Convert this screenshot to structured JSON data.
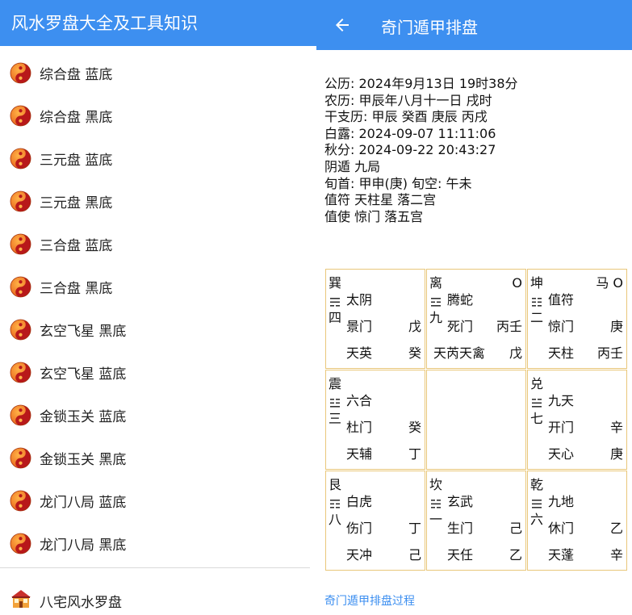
{
  "left": {
    "title": "风水罗盘大全及工具知识",
    "menu": [
      {
        "label": "综合盘  蓝底"
      },
      {
        "label": "综合盘  黑底"
      },
      {
        "label": "三元盘  蓝底"
      },
      {
        "label": "三元盘  黑底"
      },
      {
        "label": "三合盘  蓝底"
      },
      {
        "label": "三合盘  黑底"
      },
      {
        "label": "玄空飞星  黑底"
      },
      {
        "label": "玄空飞星  蓝底"
      },
      {
        "label": "金锁玉关  蓝底"
      },
      {
        "label": "金锁玉关  黑底"
      },
      {
        "label": "龙门八局  蓝底"
      },
      {
        "label": "龙门八局  黑底"
      }
    ],
    "bazhai_label": "八宅风水罗盘"
  },
  "right": {
    "title": "奇门遁甲排盘",
    "info": [
      "公历: 2024年9月13日  19时38分",
      "农历: 甲辰年八月十一日   戌时",
      "干支历: 甲辰  癸酉 庚辰  丙戌",
      "白露: 2024-09-07 11:11:06",
      "秋分: 2024-09-22 20:43:27",
      "阴遁 九局",
      "旬首: 甲申(庚) 旬空: 午未",
      "值符 天柱星 落二宫",
      "值使 惊门 落五宫"
    ],
    "palaces": [
      {
        "name": "巽",
        "mark": "",
        "num": "四",
        "god": "太阴",
        "door": "景门",
        "door_stem": "戊",
        "star": "天英",
        "star_stem": "癸"
      },
      {
        "name": "离",
        "mark": "O",
        "num": "九",
        "god": "腾蛇",
        "door": "死门",
        "door_stem": "丙壬",
        "star": "天芮天禽",
        "star_stem": "戊"
      },
      {
        "name": "坤",
        "mark": "马 O",
        "num": "二",
        "god": "值符",
        "door": "惊门",
        "door_stem": "庚",
        "star": "天柱",
        "star_stem": "丙壬"
      },
      {
        "name": "震",
        "mark": "",
        "num": "三",
        "god": "六合",
        "door": "杜门",
        "door_stem": "癸",
        "star": "天辅",
        "star_stem": "丁"
      },
      {
        "name": "",
        "mark": "",
        "num": "",
        "god": "",
        "door": "",
        "door_stem": "",
        "star": "",
        "star_stem": ""
      },
      {
        "name": "兑",
        "mark": "",
        "num": "七",
        "god": "九天",
        "door": "开门",
        "door_stem": "辛",
        "star": "天心",
        "star_stem": "庚"
      },
      {
        "name": "艮",
        "mark": "",
        "num": "八",
        "god": "白虎",
        "door": "伤门",
        "door_stem": "丁",
        "star": "天冲",
        "star_stem": "己"
      },
      {
        "name": "坎",
        "mark": "",
        "num": "一",
        "god": "玄武",
        "door": "生门",
        "door_stem": "己",
        "star": "天任",
        "star_stem": "乙"
      },
      {
        "name": "乾",
        "mark": "",
        "num": "六",
        "god": "九地",
        "door": "休门",
        "door_stem": "乙",
        "star": "天蓬",
        "star_stem": "辛"
      }
    ],
    "link_label": "奇门遁甲排盘过程"
  },
  "colors": {
    "appbar": "#3d8ff0",
    "grid_border": "#e9c77a",
    "yinyang_orange": "#f07a18",
    "yinyang_red": "#b8181a",
    "link": "#3d8ff0"
  },
  "icons": {
    "menu_item": "yin-yang-icon",
    "bazhai": "house-icon",
    "back": "arrow-left-icon"
  }
}
